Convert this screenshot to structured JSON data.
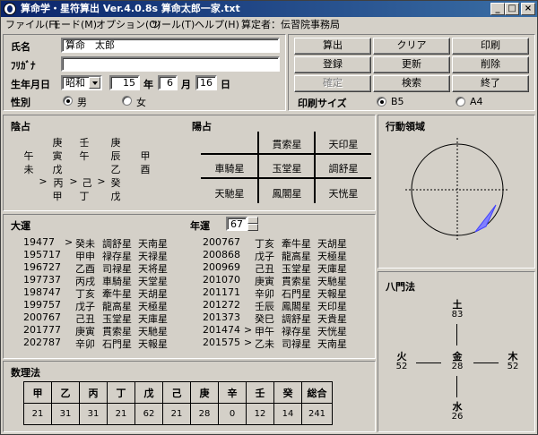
{
  "window": {
    "title": "算命学・星符算出  Ver.4.0.8s  算命太郎一家.txt",
    "minimize": "_",
    "maximize": "□",
    "close": "×"
  },
  "menu": [
    "ファイル(F)",
    "モード(M)",
    "オプション(O)",
    "ツール(T)",
    "ヘルプ(H)",
    "算定者：伝習院事務局"
  ],
  "form": {
    "name_label": "氏名",
    "name_value": "算命　太郎",
    "furigana_label": "ﾌﾘｶﾞﾅ",
    "furigana_value": "",
    "birth_label": "生年月日",
    "era": "昭和",
    "year": "15",
    "year_label": "年",
    "month": "6",
    "month_label": "月",
    "day": "16",
    "day_label": "日",
    "gender_label": "性別",
    "male": "男",
    "female": "女",
    "gender_selected": "male"
  },
  "buttons": [
    {
      "label": "算出",
      "enabled": true
    },
    {
      "label": "クリア",
      "enabled": true
    },
    {
      "label": "印刷",
      "enabled": true
    },
    {
      "label": "登録",
      "enabled": true
    },
    {
      "label": "更新",
      "enabled": true
    },
    {
      "label": "削除",
      "enabled": true
    },
    {
      "label": "確定",
      "enabled": false
    },
    {
      "label": "検索",
      "enabled": true
    },
    {
      "label": "終了",
      "enabled": true
    }
  ],
  "print_size": {
    "label": "印刷サイズ",
    "b5": "B5",
    "a4": "A4",
    "selected": "B5"
  },
  "inn": {
    "title": "陰占",
    "rows": [
      [
        "",
        "庚",
        "壬",
        "庚",
        ""
      ],
      [
        "午",
        "寅",
        "午",
        "辰",
        "甲"
      ],
      [
        "未",
        "戊",
        "",
        "乙",
        "酉"
      ]
    ],
    "arrow_row": [
      ">",
      "丙",
      ">",
      "己",
      ">",
      "癸"
    ],
    "last_row": [
      "甲",
      "丁",
      "戊"
    ]
  },
  "you": {
    "title": "陽占",
    "grid": [
      [
        "",
        "貫索星",
        "天印星"
      ],
      [
        "車騎星",
        "玉堂星",
        "調舒星"
      ],
      [
        "天馳星",
        "鳳閣星",
        "天恍星"
      ]
    ]
  },
  "koudou": {
    "title": "行動領域"
  },
  "taiun": {
    "title": "大運",
    "nenun_label": "年運",
    "nenun_value": "67",
    "left": [
      {
        "year": "1947",
        "age": "7",
        "marker": ">",
        "kanshi": "癸未",
        "star1": "調舒星",
        "star2": "天南星"
      },
      {
        "year": "1957",
        "age": "17",
        "marker": "",
        "kanshi": "甲申",
        "star1": "禄存星",
        "star2": "天禄星"
      },
      {
        "year": "1967",
        "age": "27",
        "marker": "",
        "kanshi": "乙酉",
        "star1": "司禄星",
        "star2": "天将星"
      },
      {
        "year": "1977",
        "age": "37",
        "marker": "",
        "kanshi": "丙戌",
        "star1": "車騎星",
        "star2": "天堂星"
      },
      {
        "year": "1987",
        "age": "47",
        "marker": "",
        "kanshi": "丁亥",
        "star1": "牽牛星",
        "star2": "天胡星"
      },
      {
        "year": "1997",
        "age": "57",
        "marker": "",
        "kanshi": "戊子",
        "star1": "龍高星",
        "star2": "天極星"
      },
      {
        "year": "2007",
        "age": "67",
        "marker": "",
        "kanshi": "己丑",
        "star1": "玉堂星",
        "star2": "天庫星"
      },
      {
        "year": "2017",
        "age": "77",
        "marker": "",
        "kanshi": "庚寅",
        "star1": "貫索星",
        "star2": "天馳星"
      },
      {
        "year": "2027",
        "age": "87",
        "marker": "",
        "kanshi": "辛卯",
        "star1": "石門星",
        "star2": "天報星"
      }
    ],
    "right": [
      {
        "year": "2007",
        "age": "67",
        "marker": "",
        "kanshi": "丁亥",
        "star1": "牽牛星",
        "star2": "天胡星"
      },
      {
        "year": "2008",
        "age": "68",
        "marker": "",
        "kanshi": "戊子",
        "star1": "龍高星",
        "star2": "天極星"
      },
      {
        "year": "2009",
        "age": "69",
        "marker": "",
        "kanshi": "己丑",
        "star1": "玉堂星",
        "star2": "天庫星"
      },
      {
        "year": "2010",
        "age": "70",
        "marker": "",
        "kanshi": "庚寅",
        "star1": "貫索星",
        "star2": "天馳星"
      },
      {
        "year": "2011",
        "age": "71",
        "marker": "",
        "kanshi": "辛卯",
        "star1": "石門星",
        "star2": "天報星"
      },
      {
        "year": "2012",
        "age": "72",
        "marker": "",
        "kanshi": "壬辰",
        "star1": "鳳閣星",
        "star2": "天印星"
      },
      {
        "year": "2013",
        "age": "73",
        "marker": "",
        "kanshi": "癸巳",
        "star1": "調舒星",
        "star2": "天貴星"
      },
      {
        "year": "2014",
        "age": "74",
        "marker": ">",
        "kanshi": "甲午",
        "star1": "禄存星",
        "star2": "天恍星"
      },
      {
        "year": "2015",
        "age": "75",
        "marker": ">",
        "kanshi": "乙未",
        "star1": "司禄星",
        "star2": "天南星"
      }
    ]
  },
  "hachimon": {
    "title": "八門法",
    "north": {
      "label": "土",
      "value": "83"
    },
    "west": {
      "label": "火",
      "value": "52"
    },
    "center": {
      "label": "金",
      "value": "28"
    },
    "east": {
      "label": "木",
      "value": "52"
    },
    "south": {
      "label": "水",
      "value": "26"
    }
  },
  "suuri": {
    "title": "数理法",
    "headers": [
      "甲",
      "乙",
      "丙",
      "丁",
      "戊",
      "己",
      "庚",
      "辛",
      "壬",
      "癸",
      "総合"
    ],
    "values": [
      "21",
      "31",
      "31",
      "21",
      "62",
      "21",
      "28",
      "0",
      "12",
      "14",
      "241"
    ]
  }
}
